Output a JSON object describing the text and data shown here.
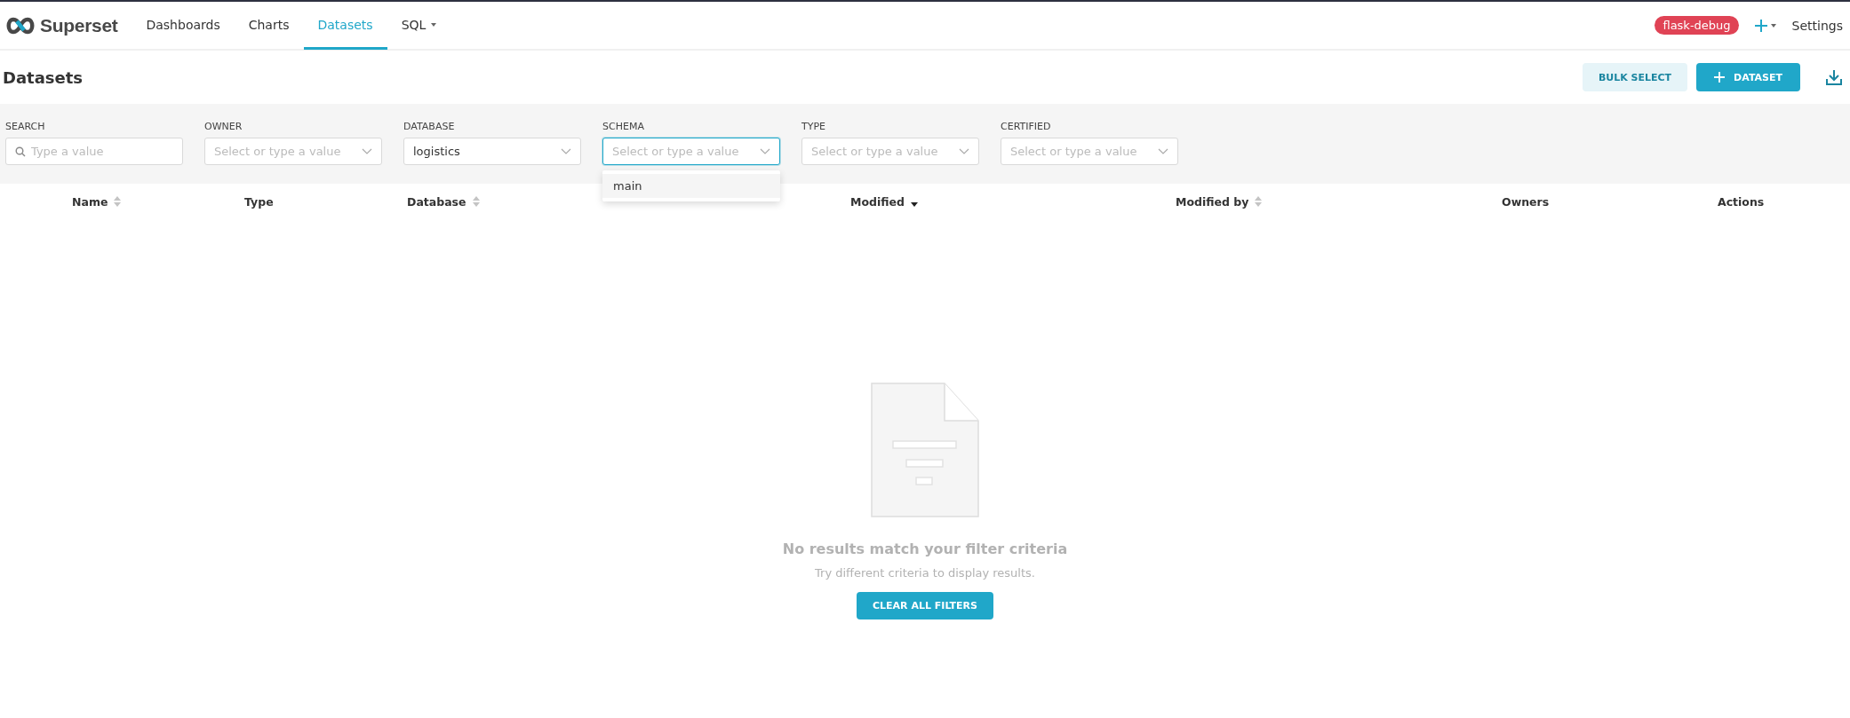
{
  "navbar": {
    "brand": "Superset",
    "items": [
      {
        "label": "Dashboards",
        "selected": false,
        "dropdown": false
      },
      {
        "label": "Charts",
        "selected": false,
        "dropdown": false
      },
      {
        "label": "Datasets",
        "selected": true,
        "dropdown": false
      },
      {
        "label": "SQL",
        "selected": false,
        "dropdown": true
      }
    ],
    "environment_badge": "flask-debug",
    "settings": "Settings"
  },
  "header": {
    "title": "Datasets",
    "buttons": [
      {
        "label": "BULK SELECT",
        "kind": "secondary"
      },
      {
        "label": "DATASET",
        "kind": "primary"
      }
    ]
  },
  "filters": [
    {
      "label": "SEARCH",
      "kind": "search",
      "placeholder": "Type a value",
      "focused": false
    },
    {
      "label": "OWNER",
      "kind": "select",
      "placeholder": "Select or type a value",
      "focused": false
    },
    {
      "label": "DATABASE",
      "kind": "select",
      "value": "logistics",
      "focused": false
    },
    {
      "label": "SCHEMA",
      "kind": "select",
      "placeholder": "Select or type a value",
      "focused": true,
      "options": [
        "main"
      ]
    },
    {
      "label": "TYPE",
      "kind": "select",
      "placeholder": "Select or type a value",
      "focused": false
    },
    {
      "label": "CERTIFIED",
      "kind": "select",
      "placeholder": "Select or type a value",
      "focused": false
    }
  ],
  "table": {
    "columns": [
      {
        "label": "Name",
        "sortable": true,
        "sorted": false
      },
      {
        "label": "Type",
        "sortable": false
      },
      {
        "label": "Database",
        "sortable": true,
        "sorted": false
      },
      {
        "sortable": false
      },
      {
        "label": "Modified",
        "sortable": true,
        "sorted": true
      },
      {
        "label": "Modified by",
        "sortable": true,
        "sorted": false
      },
      {
        "label": "Owners",
        "sortable": false
      },
      {
        "label": "Actions",
        "sortable": false
      }
    ]
  },
  "empty_state": {
    "title": "No results match your filter criteria",
    "description": "Try different criteria to display results.",
    "button": "CLEAR ALL FILTERS"
  }
}
